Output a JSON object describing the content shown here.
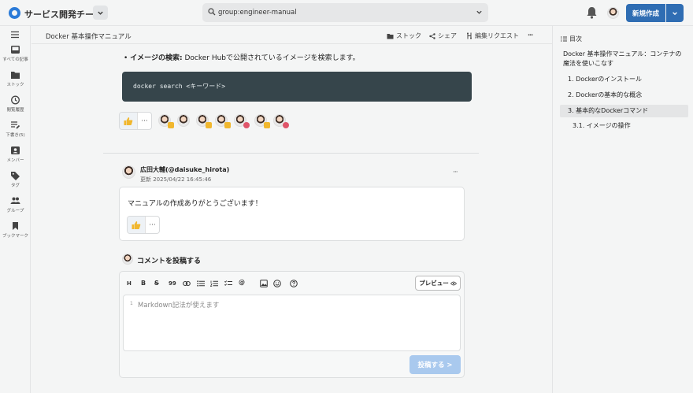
{
  "header": {
    "team_name": "サービス開発チーム",
    "search_query": "group:engineer-manual",
    "new_button_label": "新規作成"
  },
  "rail": {
    "items": [
      {
        "label": "すべての記事",
        "icon": "inbox-icon"
      },
      {
        "label": "ストック",
        "icon": "folder-icon"
      },
      {
        "label": "閲覧履歴",
        "icon": "history-icon"
      },
      {
        "label": "下書き(5)",
        "icon": "draft-icon"
      },
      {
        "label": "メンバー",
        "icon": "member-icon"
      },
      {
        "label": "タグ",
        "icon": "tag-icon"
      },
      {
        "label": "グループ",
        "icon": "group-icon"
      },
      {
        "label": "ブックマーク",
        "icon": "bookmark-icon"
      }
    ]
  },
  "topbar": {
    "title": "Docker 基本操作マニュアル",
    "stock_label": "ストック",
    "share_label": "シェア",
    "edit_request_label": "編集リクエスト",
    "more_label": "···"
  },
  "article": {
    "bullet_bold": "イメージの検索:",
    "bullet_text": " Docker Hubで公開されているイメージを検索します。",
    "code": "docker search <キーワード>",
    "reaction_more": "···"
  },
  "comment": {
    "author": "広田大輔(@daisuke_hirota)",
    "date": "更新 2025/04/22 16:45:46",
    "menu": "···",
    "text": "マニュアルの作成ありがとうございます！",
    "reaction_more": "···"
  },
  "post_comment": {
    "title": "コメントを投稿する",
    "toolbar": [
      "H",
      "B",
      "S",
      "99",
      "link",
      "ul",
      "ol",
      "task",
      "@",
      "image",
      "emoji",
      "help"
    ],
    "preview_label": "プレビュー",
    "line_number": "1",
    "placeholder": "Markdown記法が使えます",
    "submit_label": "投稿する >"
  },
  "toc": {
    "heading": "目次",
    "items": [
      {
        "label": "Docker 基本操作マニュアル：コンテナの魔法を使いこなす",
        "level": 0
      },
      {
        "label": "1. Dockerのインストール",
        "level": 1
      },
      {
        "label": "2. Dockerの基本的な概念",
        "level": 1
      },
      {
        "label": "3. 基本的なDockerコマンド",
        "level": 1,
        "active": true
      },
      {
        "label": "3.1. イメージの操作",
        "level": 2
      }
    ]
  },
  "colors": {
    "brand": "#2f6db3",
    "code_bg": "#36454b",
    "submit_disabled": "#a9c9ee"
  }
}
